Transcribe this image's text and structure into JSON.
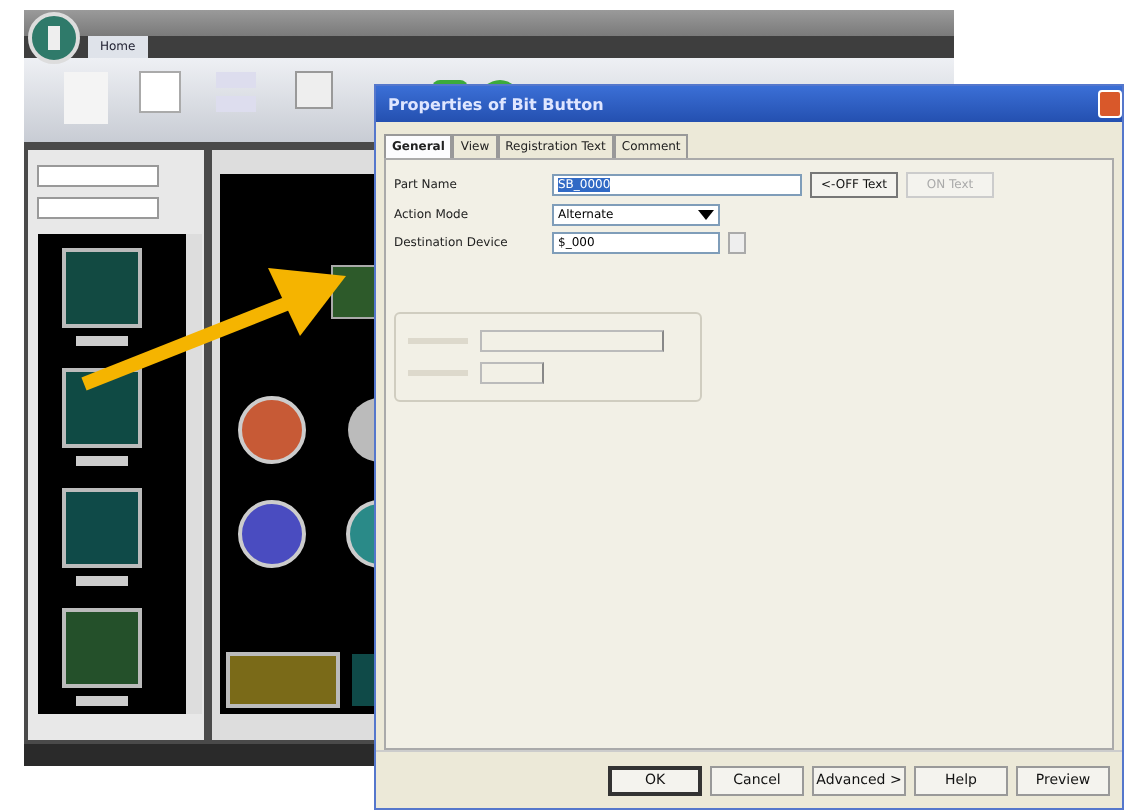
{
  "app": {
    "ribbon_tabs": [
      {
        "label": "Home",
        "selected": true
      }
    ]
  },
  "dialog": {
    "title": "Properties of Bit Button",
    "tabs": [
      {
        "label": "General",
        "selected": true
      },
      {
        "label": "View",
        "selected": false
      },
      {
        "label": "Registration Text",
        "selected": false
      },
      {
        "label": "Comment",
        "selected": false
      }
    ],
    "part_name": {
      "label": "Part Name",
      "value": "SB_0000"
    },
    "text_buttons": [
      {
        "label": "<-OFF Text",
        "disabled": false
      },
      {
        "label": "ON Text",
        "disabled": true
      }
    ],
    "action_mode": {
      "label": "Action Mode",
      "value": "Alternate"
    },
    "destination_device": {
      "label": "Destination Device",
      "value": "$_000"
    },
    "option_group": {
      "disabled": true
    },
    "buttons": [
      {
        "label": "OK",
        "default": true
      },
      {
        "label": "Cancel",
        "default": false
      },
      {
        "label": "Advanced >",
        "default": false
      },
      {
        "label": "Help",
        "default": false
      },
      {
        "label": "Preview",
        "default": false
      }
    ]
  }
}
